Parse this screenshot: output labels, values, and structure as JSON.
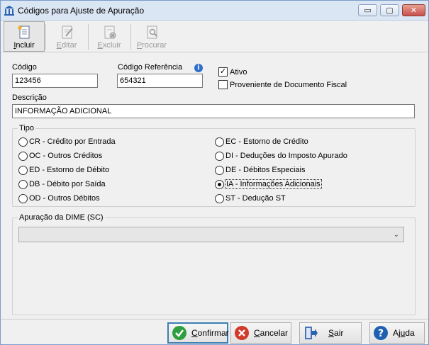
{
  "window": {
    "title": "Códigos para Ajuste de Apuração",
    "minimize_glyph": "▭",
    "maximize_glyph": "▢",
    "close_glyph": "✕"
  },
  "toolbar": {
    "incluir": {
      "first": "I",
      "rest": "ncluir",
      "icon": "new-document-icon",
      "enabled": true
    },
    "editar": {
      "first": "E",
      "rest": "ditar",
      "icon": "edit-document-icon",
      "enabled": false
    },
    "excluir": {
      "first": "E",
      "rest": "xcluir",
      "icon": "delete-document-icon",
      "enabled": false
    },
    "procurar": {
      "first": "P",
      "rest": "rocurar",
      "icon": "search-document-icon",
      "enabled": false
    }
  },
  "form": {
    "codigo_label": "Código",
    "codigo_value": "123456",
    "codigo_ref_label": "Código Referência",
    "codigo_ref_value": "654321",
    "ativo_label": "Ativo",
    "ativo_checked": true,
    "proveniente_label": "Proveniente de Documento Fiscal",
    "proveniente_checked": false,
    "descricao_label": "Descrição",
    "descricao_value": "INFORMAÇÃO ADICIONAL"
  },
  "tipo": {
    "title": "Tipo",
    "left": [
      {
        "label": "CR - Crédito por Entrada",
        "selected": false
      },
      {
        "label": "OC - Outros Créditos",
        "selected": false
      },
      {
        "label": "ED - Estorno de Débito",
        "selected": false
      },
      {
        "label": "DB - Débito por Saída",
        "selected": false
      },
      {
        "label": "OD - Outros Débitos",
        "selected": false
      }
    ],
    "right": [
      {
        "label": "EC - Estorno de Crédito",
        "selected": false
      },
      {
        "label": "DI - Deduções do Imposto Apurado",
        "selected": false
      },
      {
        "label": "DE - Débitos Especiais",
        "selected": false
      },
      {
        "label": "IA - Informações Adicionais",
        "selected": true
      },
      {
        "label": "ST - Dedução ST",
        "selected": false
      }
    ]
  },
  "dime": {
    "title": "Apuração da DIME (SC)",
    "selected_value": "",
    "arrow_glyph": "⌄"
  },
  "actions": {
    "confirmar": {
      "first": "C",
      "rest": "onfirmar",
      "icon": "check-circle-icon"
    },
    "cancelar": {
      "first": "C",
      "rest": "ancelar",
      "icon": "cancel-circle-icon"
    },
    "sair": {
      "first": "S",
      "rest": "air",
      "icon": "exit-door-icon"
    },
    "ajuda": {
      "pre": "Aj",
      "first": "u",
      "rest": "da",
      "icon": "help-circle-icon"
    }
  },
  "colors": {
    "accent": "#3c7fb1",
    "confirm_green": "#2e9e3e",
    "cancel_red": "#d23a2a",
    "help_blue": "#1f5fb0"
  }
}
